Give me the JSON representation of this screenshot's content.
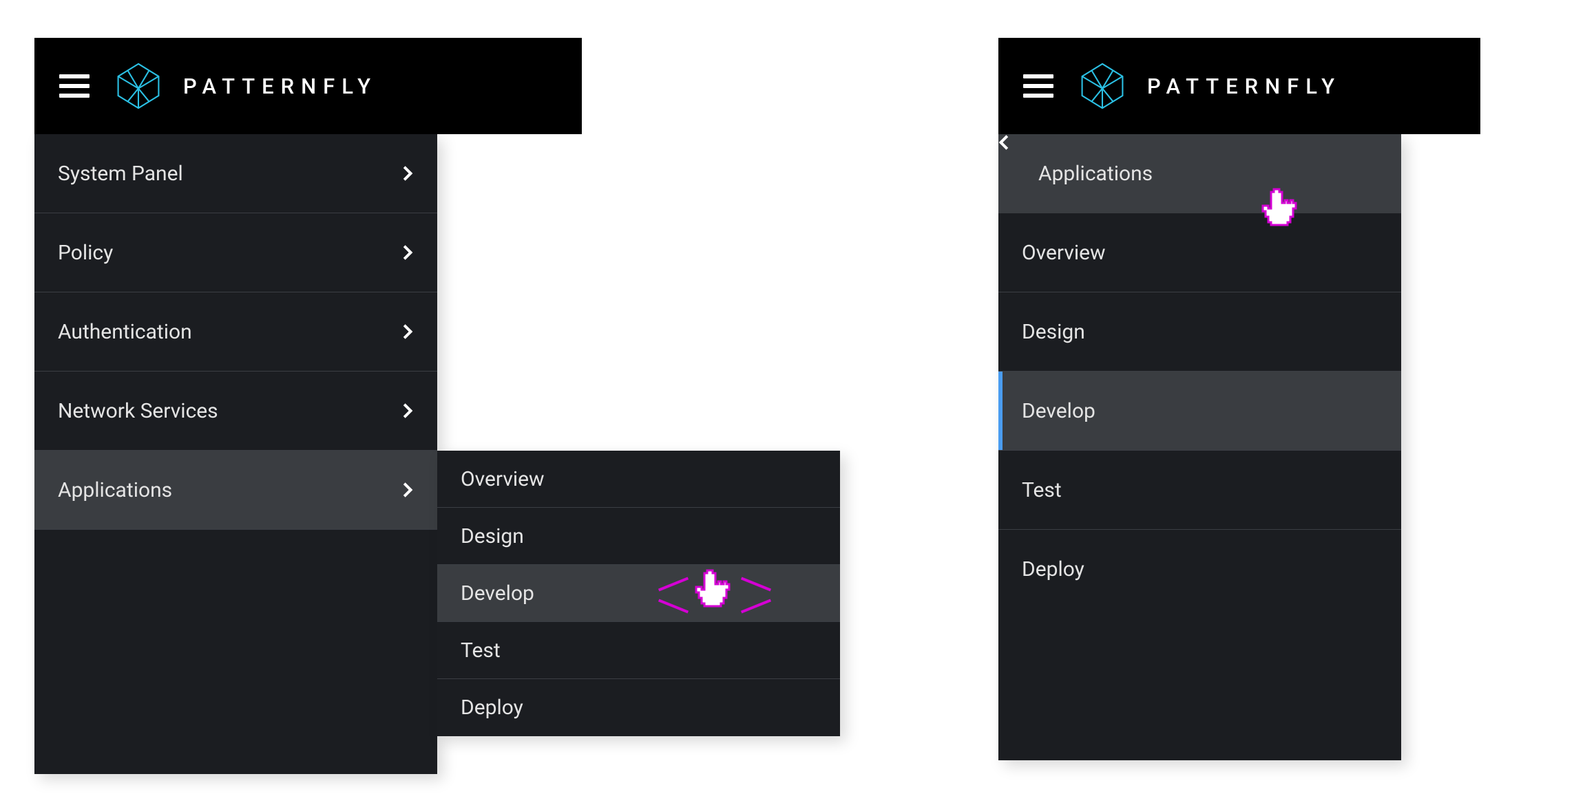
{
  "brand": "PATTERNFLY",
  "left": {
    "nav": {
      "items": [
        {
          "label": "System Panel"
        },
        {
          "label": "Policy"
        },
        {
          "label": "Authentication"
        },
        {
          "label": "Network Services"
        },
        {
          "label": "Applications"
        }
      ]
    },
    "flyout": {
      "items": [
        {
          "label": "Overview"
        },
        {
          "label": "Design"
        },
        {
          "label": "Develop"
        },
        {
          "label": "Test"
        },
        {
          "label": "Deploy"
        }
      ]
    }
  },
  "right": {
    "drill": {
      "back_label": "Applications",
      "items": [
        {
          "label": "Overview"
        },
        {
          "label": "Design"
        },
        {
          "label": "Develop"
        },
        {
          "label": "Test"
        },
        {
          "label": "Deploy"
        }
      ]
    }
  }
}
